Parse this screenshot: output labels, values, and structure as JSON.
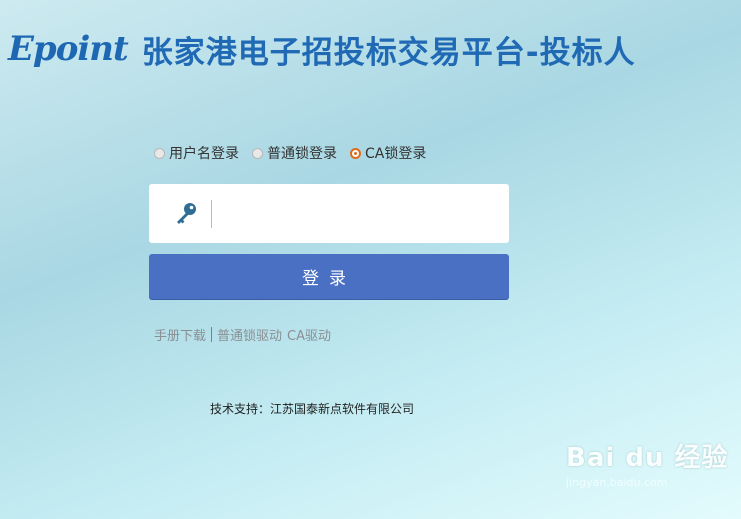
{
  "header": {
    "logo": "Epoint",
    "title": "张家港电子招投标交易平台-投标人"
  },
  "login_types": [
    {
      "label": "用户名登录",
      "selected": false
    },
    {
      "label": "普通锁登录",
      "selected": false
    },
    {
      "label": "CA锁登录",
      "selected": true
    }
  ],
  "ca_input": {
    "icon": "key-icon",
    "value": ""
  },
  "login_button": {
    "label": "登录"
  },
  "links": {
    "manual": "手册下载",
    "driver_normal": "普通锁驱动",
    "driver_ca": "CA驱动"
  },
  "support": "技术支持：江苏国泰新点软件有限公司",
  "watermark": {
    "main": "Bai du 经验",
    "sub": "jingyan.baidu.com"
  }
}
